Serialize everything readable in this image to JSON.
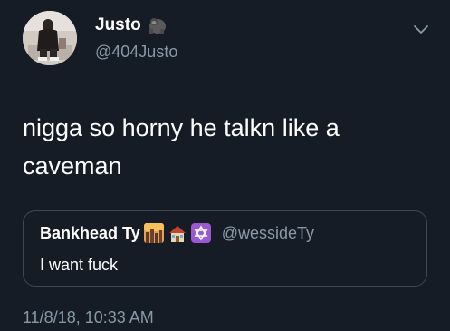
{
  "author": {
    "display_name": "Justo",
    "name_emoji": "gorilla-emoji",
    "handle": "@404Justo",
    "avatar": "avatar-photo"
  },
  "menu_icon": "chevron-down-icon",
  "tweet": {
    "text": "nigga so horny he talkn like a caveman",
    "timestamp": "11/8/18, 10:33 AM"
  },
  "quoted_tweet": {
    "display_name": "Bankhead Ty",
    "name_emojis": [
      "city-sunset-emoji",
      "house-emoji",
      "star-of-david-emoji"
    ],
    "handle": "@wessideTy",
    "text": "I want fuck"
  },
  "colors": {
    "background": "#151c26",
    "text_primary": "#ffffff",
    "text_secondary": "#8899a6",
    "border": "#3d4853"
  }
}
